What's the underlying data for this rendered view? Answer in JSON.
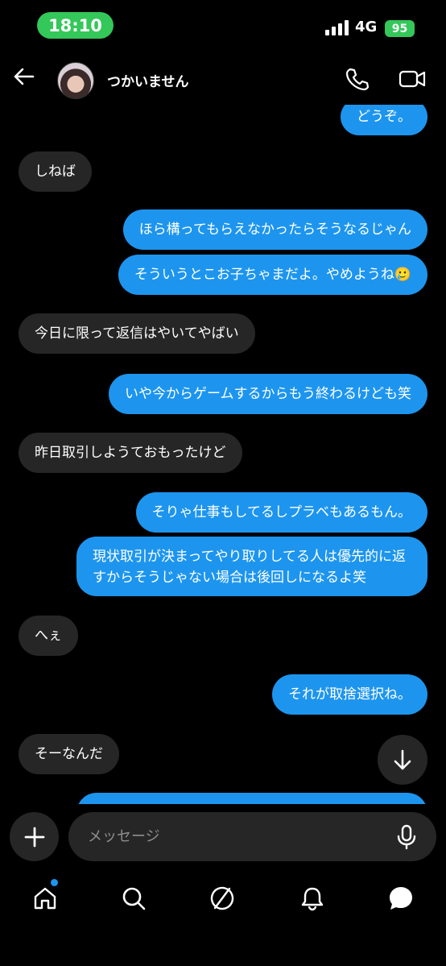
{
  "status_bar": {
    "time": "18:10",
    "network": "4G",
    "battery": "95"
  },
  "header": {
    "contact_name": "つかいません"
  },
  "messages": [
    {
      "text": "どうぞ。",
      "sender": "me"
    },
    {
      "text": "しねば",
      "sender": "them"
    },
    {
      "text": "ほら構ってもらえなかったらそうなるじゃん",
      "sender": "me"
    },
    {
      "text": "そういうとこお子ちゃまだよ。やめようね",
      "emoji": "🥲",
      "sender": "me"
    },
    {
      "text": "今日に限って返信はやいてやばい",
      "sender": "them"
    },
    {
      "text": "いや今からゲームするからもう終わるけども笑",
      "sender": "me"
    },
    {
      "text": "昨日取引しようておもったけど",
      "sender": "them"
    },
    {
      "text": "そりゃ仕事もしてるしプラベもあるもん。",
      "sender": "me"
    },
    {
      "text_line1": "現状取引が決まってやり取りしてる人は優先的に返",
      "text_line2": "すからそうじゃない場合は後回しになるよ笑",
      "sender": "me"
    },
    {
      "text": "へぇ",
      "sender": "them"
    },
    {
      "text": "それが取捨選択ね。",
      "sender": "me"
    },
    {
      "text": "そーなんだ",
      "sender": "them"
    }
  ],
  "composer": {
    "placeholder": "メッセージ"
  },
  "icons": {
    "back": "arrow-left-icon",
    "call": "phone-icon",
    "video": "video-camera-icon",
    "scroll": "arrow-down-icon",
    "plus": "plus-icon",
    "mic": "microphone-icon",
    "home": "home-icon",
    "search": "search-icon",
    "explore": "compass-icon",
    "notifications": "bell-icon",
    "messages": "chat-bubble-icon"
  },
  "colors": {
    "outgoing_bubble": "#1d95ee",
    "incoming_bubble": "#262626",
    "background": "#000000",
    "status_pill": "#34c759"
  }
}
